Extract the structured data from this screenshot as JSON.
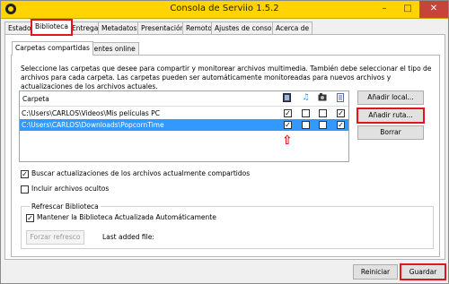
{
  "window": {
    "title": "Consola de Serviio 1.5.2",
    "minimize": "–",
    "maximize": "□",
    "close": "✕"
  },
  "tabs": [
    "Estado",
    "Biblioteca",
    "Entrega",
    "Metadatos",
    "Presentación",
    "Remoto",
    "Ajustes de consola",
    "Acerca de"
  ],
  "active_tab": "Biblioteca",
  "subtabs": [
    "Carpetas compartidas",
    "Fuentes online"
  ],
  "active_subtab": "Carpetas compartidas",
  "description": "Seleccione las carpetas que desee para compartir y monitorear archivos multimedia. También debe seleccionar el tipo de archivos para cada carpeta. Las carpetas pueden ser automáticamente monitoreadas para nuevos archivos y actualizaciones de los archivos actuales.",
  "folder_list": {
    "column_label": "Carpeta",
    "type_icons": [
      "video-icon",
      "music-icon",
      "image-icon",
      "document-icon"
    ],
    "rows": [
      {
        "path": "C:\\Users\\CARLOS\\Videos\\Mis películas PC",
        "checks": [
          true,
          false,
          false,
          true
        ],
        "selected": false
      },
      {
        "path": "C:\\Users\\CARLOS\\Downloads\\PopcornTime",
        "checks": [
          true,
          false,
          false,
          true
        ],
        "selected": true
      }
    ]
  },
  "side_buttons": {
    "add_local": "Añadir local...",
    "add_path": "Añadir ruta...",
    "delete": "Borrar"
  },
  "options": {
    "search_updates": "Buscar actualizaciones de los archivos actualmente compartidos",
    "search_updates_checked": true,
    "include_hidden": "Incluir archivos ocultos",
    "include_hidden_checked": false
  },
  "refresh_group": {
    "title": "Refrescar Biblioteca",
    "keep_updated": "Mantener la Biblioteca Actualizada Automáticamente",
    "keep_updated_checked": true,
    "force_refresh": "Forzar refresco",
    "last_added": "Last added file:"
  },
  "footer": {
    "reset": "Reiniciar",
    "save": "Guardar"
  },
  "annotation_color": "#e3141e",
  "accent": "#ffd400"
}
